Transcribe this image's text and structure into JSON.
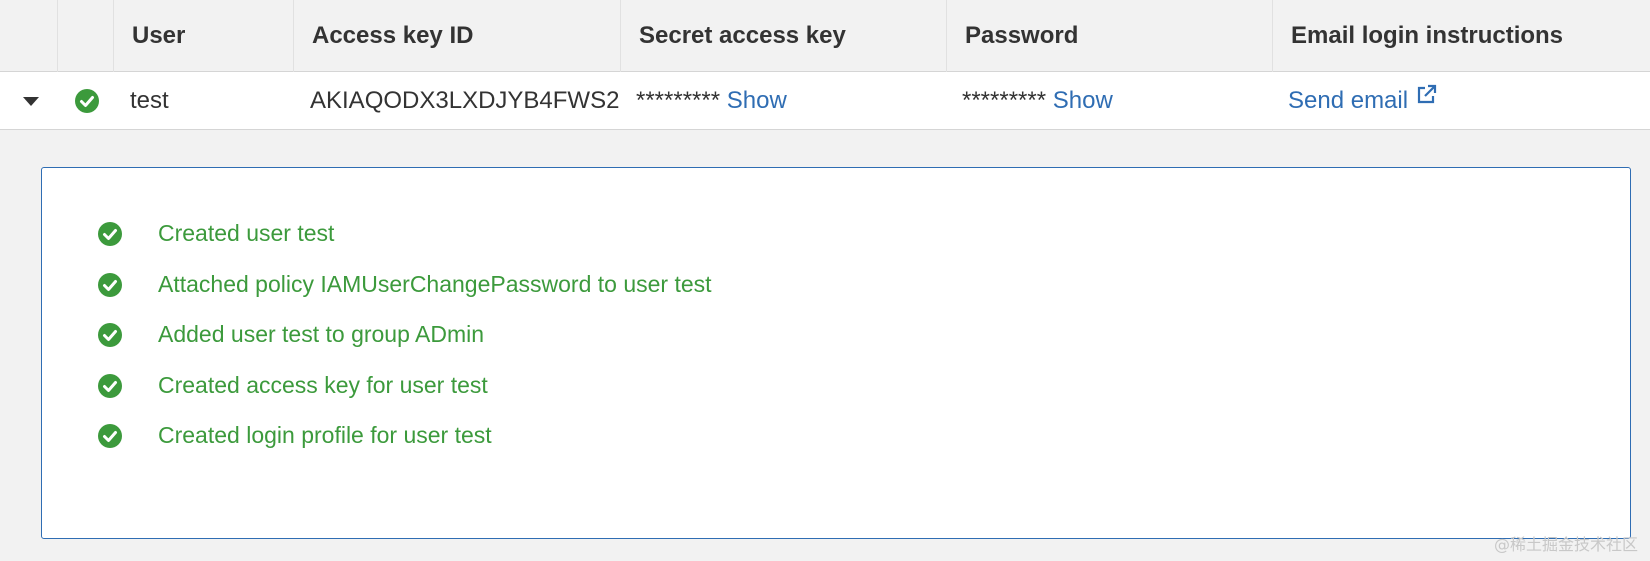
{
  "table": {
    "headers": {
      "user": "User",
      "access_key_id": "Access key ID",
      "secret_access_key": "Secret access key",
      "password": "Password",
      "email_login": "Email login instructions"
    },
    "row": {
      "user": "test",
      "access_key_id": "AKIAQODX3LXDJYB4FWS2",
      "secret_mask": "*********",
      "secret_show": "Show",
      "password_mask": "*********",
      "password_show": "Show",
      "send_email": "Send email"
    }
  },
  "messages": [
    "Created user test",
    "Attached policy IAMUserChangePassword to user test",
    "Added user test to group ADmin",
    "Created access key for user test",
    "Created login profile for user test"
  ],
  "watermark": "@稀土掘金技术社区",
  "colors": {
    "success": "#3c9a3c",
    "link": "#2f6db3",
    "panel_border": "#2f6db3"
  },
  "icons": [
    "caret-down-icon",
    "check-circle-icon",
    "external-link-icon"
  ]
}
